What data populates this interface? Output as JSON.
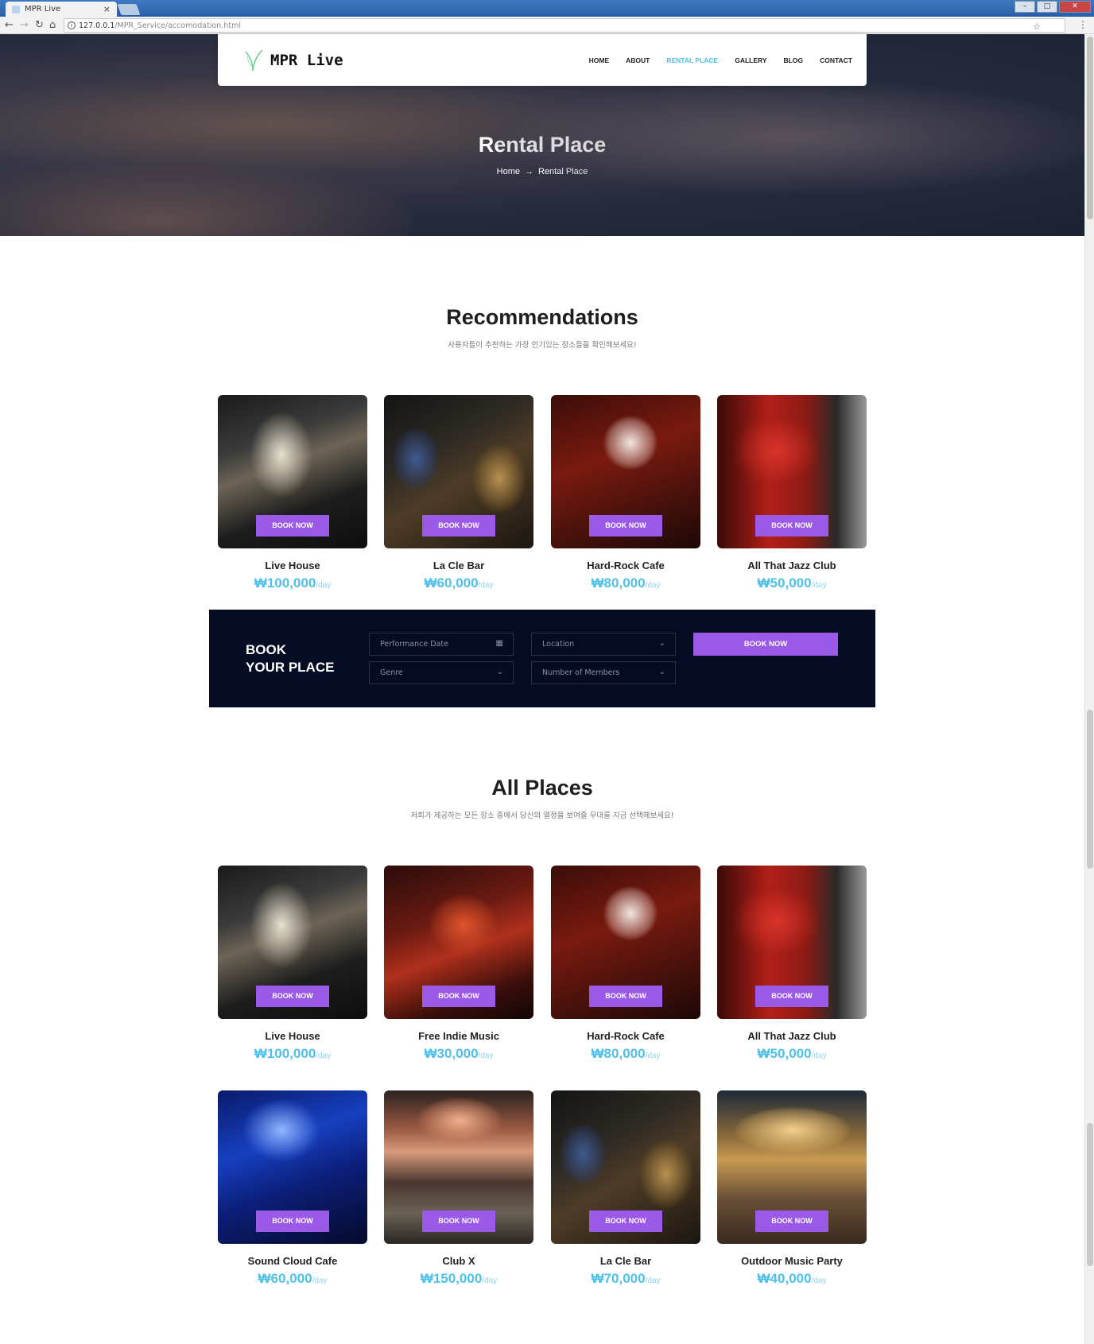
{
  "browser": {
    "tab_title": "MPR Live",
    "tab_close": "×",
    "url_host": "127.0.0.1",
    "url_path": "/MPR_Service/accomodation.html"
  },
  "nav": {
    "brand": "MPR Live",
    "links": [
      "HOME",
      "ABOUT",
      "RENTAL PLACE",
      "GALLERY",
      "BLOG",
      "CONTACT"
    ],
    "active": "RENTAL PLACE"
  },
  "hero": {
    "title": "Rental Place",
    "breadcrumb_home": "Home",
    "breadcrumb_arrow": "→",
    "breadcrumb_current": "Rental Place"
  },
  "recommendations": {
    "title": "Recommendations",
    "subtitle": "사용자들이 추천하는 가장 인기있는 장소들을 확인해보세요!",
    "items": [
      {
        "name": "Live House",
        "price": "₩100,000",
        "unit": "/day",
        "button": "BOOK NOW"
      },
      {
        "name": "La Cle Bar",
        "price": "₩60,000",
        "unit": "/day",
        "button": "BOOK NOW"
      },
      {
        "name": "Hard-Rock Cafe",
        "price": "₩80,000",
        "unit": "/day",
        "button": "BOOK NOW"
      },
      {
        "name": "All That Jazz Club",
        "price": "₩50,000",
        "unit": "/day",
        "button": "BOOK NOW"
      }
    ]
  },
  "booking": {
    "title_line1": "BOOK",
    "title_line2": "YOUR PLACE",
    "date_placeholder": "Performance Date",
    "location_placeholder": "Location",
    "genre_placeholder": "Genre",
    "members_placeholder": "Number of Members",
    "button": "BOOK NOW"
  },
  "all_places": {
    "title": "All Places",
    "subtitle": "저희가 제공하는 모든 장소 중에서 당신의 열정을 보여줄 무대를 지금 선택해보세요!",
    "items": [
      {
        "name": "Live House",
        "price": "₩100,000",
        "unit": "/day",
        "button": "BOOK NOW"
      },
      {
        "name": "Free Indie Music",
        "price": "₩30,000",
        "unit": "/day",
        "button": "BOOK NOW"
      },
      {
        "name": "Hard-Rock Cafe",
        "price": "₩80,000",
        "unit": "/day",
        "button": "BOOK NOW"
      },
      {
        "name": "All That Jazz Club",
        "price": "₩50,000",
        "unit": "/day",
        "button": "BOOK NOW"
      },
      {
        "name": "Sound Cloud Cafe",
        "price": "₩60,000",
        "unit": "/day",
        "button": "BOOK NOW"
      },
      {
        "name": "Club X",
        "price": "₩150,000",
        "unit": "/day",
        "button": "BOOK NOW"
      },
      {
        "name": "La Cle Bar",
        "price": "₩70,000",
        "unit": "/day",
        "button": "BOOK NOW"
      },
      {
        "name": "Outdoor Music Party",
        "price": "₩40,000",
        "unit": "/day",
        "button": "BOOK NOW"
      }
    ]
  },
  "colors": {
    "accent_purple": "#9b59e8",
    "price_blue": "#4ec0ea",
    "booking_bg": "#050b23"
  },
  "icons": {
    "calendar": "calendar-icon",
    "dropdown": "chevron-down-icon"
  }
}
